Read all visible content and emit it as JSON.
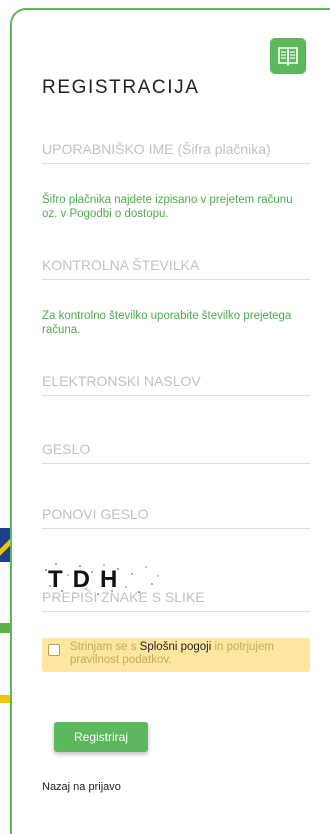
{
  "form": {
    "title": "REGISTRACIJA",
    "manual_icon": "book-icon",
    "username_placeholder": "UPORABNIŠKO IME (Šifra plačnika)",
    "username_hint": "Šifro plačnika najdete izpisano v prejetem računu oz. v Pogodbi o dostopu.",
    "control_number_placeholder": "KONTROLNA ŠTEVILKA",
    "control_number_hint": "Za kontrolno številko uporabite številko prejetega računa.",
    "email_placeholder": "ELEKTRONSKI NASLOV",
    "password_placeholder": "GESLO",
    "password_repeat_placeholder": "PONOVI GESLO",
    "captcha_text": "TDH",
    "captcha_placeholder": "PREPIŠI ZNAKE S SLIKE",
    "terms_prefix": "Strinjam se s ",
    "terms_link": "Splošni pogoji",
    "terms_suffix": " in potrjujem pravilnost podatkov.",
    "terms_checked": false,
    "submit_label": "Registriraj",
    "back_link": "Nazaj na prijavo"
  },
  "colors": {
    "accent": "#5cb85c",
    "hint_text": "#4cae4c",
    "terms_background": "#fde7a0"
  }
}
